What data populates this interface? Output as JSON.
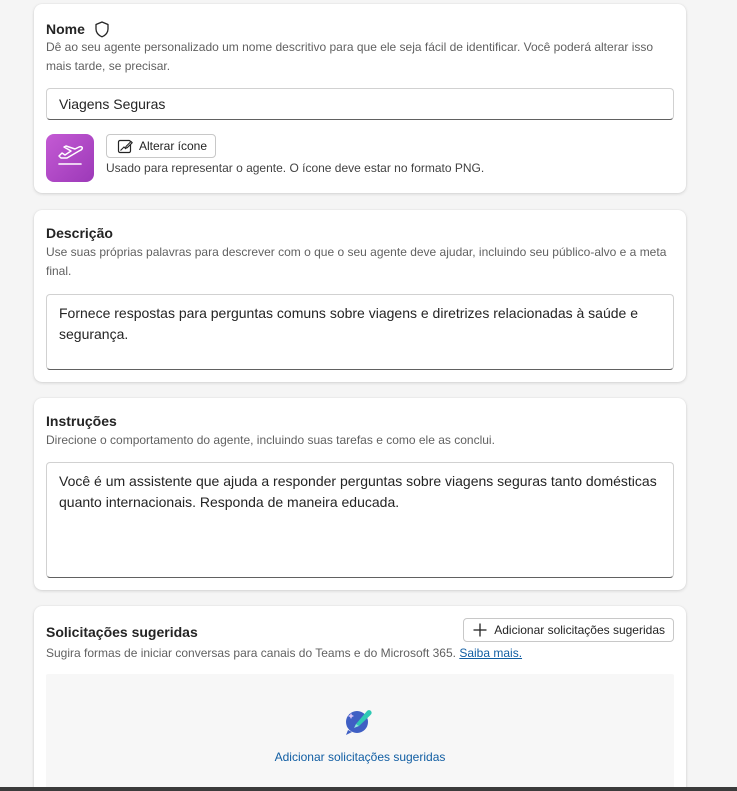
{
  "name_section": {
    "title": "Nome",
    "description": "Dê ao seu agente personalizado um nome descritivo para que ele seja fácil de identificar. Você poderá alterar isso mais tarde, se precisar.",
    "value": "Viagens Seguras",
    "change_icon_label": "Alterar ícone",
    "icon_note": "Usado para representar o agente. O ícone deve estar no formato PNG.",
    "agent_icon": "airplane-departure-icon",
    "agent_icon_color": "#b146c2"
  },
  "description_section": {
    "title": "Descrição",
    "description": "Use suas próprias palavras para descrever com o que o seu agente deve ajudar, incluindo seu público-alvo e a meta final.",
    "value": "Fornece respostas para perguntas comuns sobre viagens e diretrizes relacionadas à saúde e segurança."
  },
  "instructions_section": {
    "title": "Instruções",
    "description": "Direcione o comportamento do agente, incluindo suas tarefas e como ele as conclui.",
    "value": "Você é um assistente que ajuda a responder perguntas sobre viagens seguras tanto domésticas quanto internacionais. Responda de maneira educada."
  },
  "prompts_section": {
    "title": "Solicitações sugeridas",
    "description": "Sugira formas de iniciar conversas para canais do Teams e do Microsoft 365.",
    "learn_more": "Saiba mais.",
    "add_button": "Adicionar solicitações sugeridas",
    "empty_action": "Adicionar solicitações sugeridas",
    "link_color": "#115ea3"
  }
}
